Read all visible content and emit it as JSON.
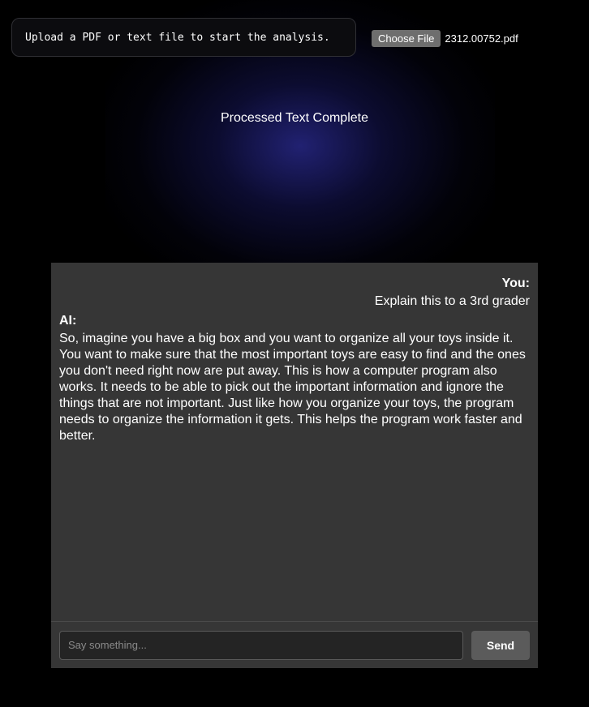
{
  "upload": {
    "prompt": "Upload a PDF or text file to start the analysis.",
    "choose_label": "Choose File",
    "file_name": "2312.00752.pdf"
  },
  "status": {
    "text": "Processed Text Complete"
  },
  "chat": {
    "messages": [
      {
        "speaker": "You:",
        "text": "Explain this to a 3rd grader"
      },
      {
        "speaker": "AI:",
        "text": "So, imagine you have a big box and you want to organize all your toys inside it. You want to make sure that the most important toys are easy to find and the ones you don't need right now are put away. This is how a computer program also works. It needs to be able to pick out the important information and ignore the things that are not important. Just like how you organize your toys, the program needs to organize the information it gets. This helps the program work faster and better."
      }
    ],
    "input_placeholder": "Say something...",
    "send_label": "Send"
  },
  "colors": {
    "background": "#000000",
    "glow": "#23237a",
    "chat_panel": "#363636",
    "send_button": "#5b5b5b"
  }
}
